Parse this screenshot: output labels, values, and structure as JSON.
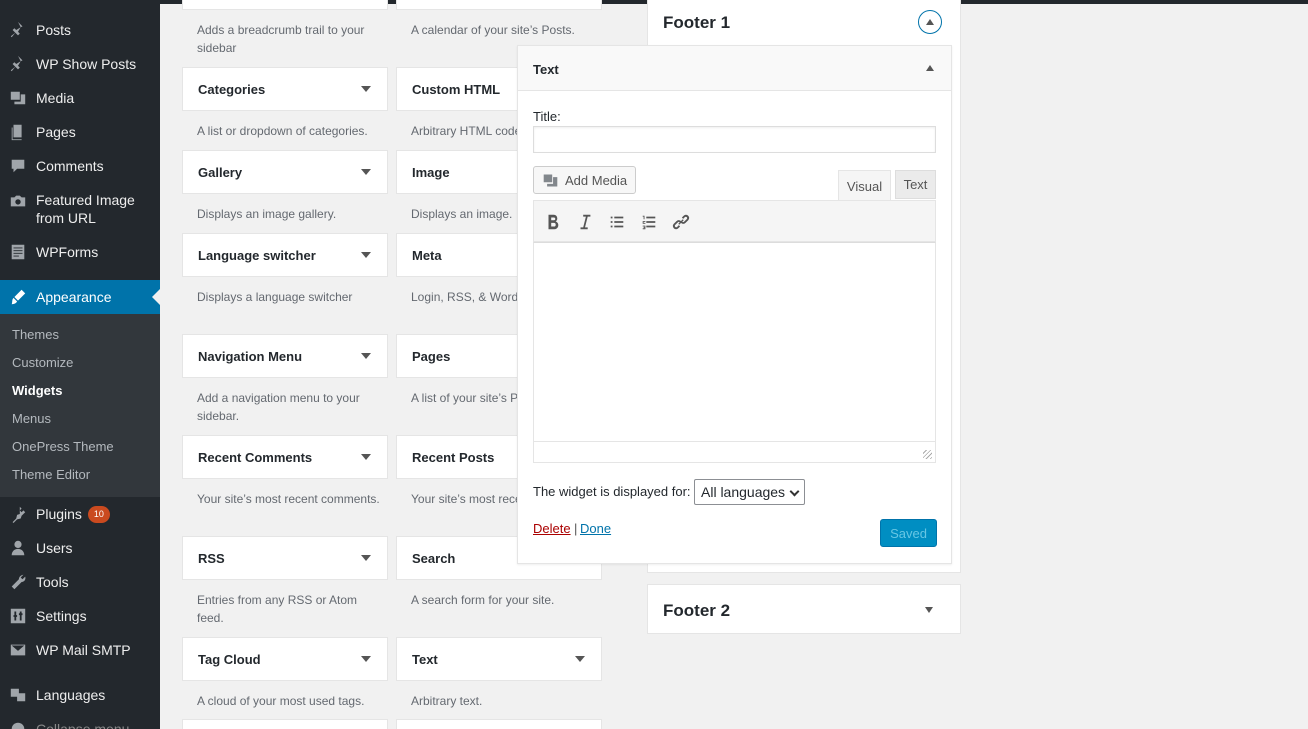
{
  "sidebar": {
    "items": [
      {
        "label": "Posts",
        "icon": "pushpin-icon"
      },
      {
        "label": "WP Show Posts",
        "icon": "pushpin-icon"
      },
      {
        "label": "Media",
        "icon": "media-icon"
      },
      {
        "label": "Pages",
        "icon": "pages-icon"
      },
      {
        "label": "Comments",
        "icon": "comment-icon"
      },
      {
        "label": "Featured Image from URL",
        "label_line1": "Featured Image",
        "label_line2": "from URL",
        "icon": "camera-icon"
      },
      {
        "label": "WPForms",
        "icon": "forms-icon"
      },
      {
        "label": "Appearance",
        "icon": "paintbrush-icon"
      },
      {
        "label": "Plugins",
        "icon": "plug-icon",
        "badge": "10"
      },
      {
        "label": "Users",
        "icon": "user-icon"
      },
      {
        "label": "Tools",
        "icon": "wrench-icon"
      },
      {
        "label": "Settings",
        "icon": "settings-icon"
      },
      {
        "label": "WP Mail SMTP",
        "icon": "mail-icon"
      },
      {
        "label": "Languages",
        "icon": "translate-icon"
      },
      {
        "label": "Collapse menu",
        "icon": "collapse-icon"
      }
    ],
    "submenu": [
      "Themes",
      "Customize",
      "Widgets",
      "Menus",
      "OnePress Theme",
      "Theme Editor"
    ],
    "current_submenu": "Widgets"
  },
  "widgets": {
    "left": [
      {
        "name": "",
        "desc": "Adds a breadcrumb trail to your sidebar"
      },
      {
        "name": "Categories",
        "desc": "A list or dropdown of categories."
      },
      {
        "name": "Gallery",
        "desc": "Displays an image gallery."
      },
      {
        "name": "Language switcher",
        "desc": "Displays a language switcher"
      },
      {
        "name": "Navigation Menu",
        "desc": "Add a navigation menu to your sidebar."
      },
      {
        "name": "Recent Comments",
        "desc": "Your site’s most recent comments."
      },
      {
        "name": "RSS",
        "desc": "Entries from any RSS or Atom feed."
      },
      {
        "name": "Tag Cloud",
        "desc": "A cloud of your most used tags."
      }
    ],
    "right": [
      {
        "name": "",
        "desc": "A calendar of your site’s Posts."
      },
      {
        "name": "Custom HTML",
        "desc": "Arbitrary HTML code."
      },
      {
        "name": "Image",
        "desc": "Displays an image."
      },
      {
        "name": "Meta",
        "desc": "Login, RSS, & WordPress.org links."
      },
      {
        "name": "Pages",
        "desc": "A list of your site’s Pages."
      },
      {
        "name": "Recent Posts",
        "desc": "Your site’s most recent Posts."
      },
      {
        "name": "Search",
        "desc": "A search form for your site."
      },
      {
        "name": "Text",
        "desc": "Arbitrary text."
      }
    ]
  },
  "footer1": {
    "title": "Footer 1"
  },
  "footer2": {
    "title": "Footer 2"
  },
  "text_widget": {
    "header": "Text",
    "title_label": "Title:",
    "title_value": "",
    "add_media": "Add Media",
    "tab_visual": "Visual",
    "tab_text": "Text",
    "toolbar": [
      "bold",
      "italic",
      "bulleted-list",
      "numbered-list",
      "link"
    ],
    "displayed_for_label": "The widget is displayed for:",
    "language_select": "All languages",
    "delete": "Delete",
    "separator": "|",
    "done": "Done",
    "saved": "Saved"
  },
  "colors": {
    "admin_bar": "#23282d",
    "accent": "#0073aa",
    "button": "#008ec2",
    "delete": "#a00",
    "badge": "#ca4a1f"
  }
}
